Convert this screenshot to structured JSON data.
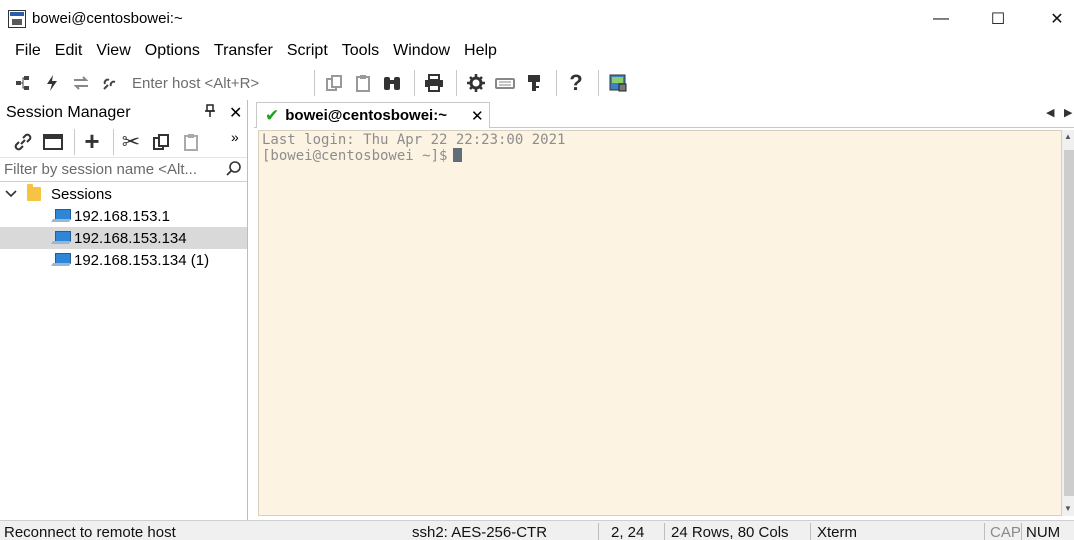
{
  "window": {
    "title": "bowei@centosbowei:~",
    "minimize_glyph": "—",
    "maximize_glyph": "☐",
    "close_glyph": "✕"
  },
  "menu": [
    "File",
    "Edit",
    "View",
    "Options",
    "Transfer",
    "Script",
    "Tools",
    "Window",
    "Help"
  ],
  "toolbar": {
    "host_placeholder": "Enter host <Alt+R>",
    "icons": [
      "connect-icon",
      "quick-connect-icon",
      "reconnect-icon",
      "disconnect-icon",
      "copy-icon",
      "paste-icon",
      "find-icon",
      "print-icon",
      "settings-icon",
      "keymap-icon",
      "key-icon",
      "help-icon",
      "sftp-icon"
    ]
  },
  "session_manager": {
    "title": "Session Manager",
    "filter_placeholder": "Filter by session name <Alt...",
    "tree": {
      "folder_label": "Sessions",
      "items": [
        {
          "label": "192.168.153.1",
          "selected": false
        },
        {
          "label": "192.168.153.134",
          "selected": true
        },
        {
          "label": "192.168.153.134 (1)",
          "selected": false
        }
      ]
    }
  },
  "tabs": [
    {
      "label": "bowei@centosbowei:~",
      "status": "connected"
    }
  ],
  "terminal": {
    "lines": [
      "Last login: Thu Apr 22 22:23:00 2021",
      "[bowei@centosbowei ~]$"
    ],
    "background": "#fcf3e2",
    "text_color": "#8d8d8d"
  },
  "status_bar": {
    "message": "Reconnect to remote host",
    "protocol": "ssh2: AES-256-CTR",
    "cursor_pos": "2,  24",
    "size": "24 Rows, 80 Cols",
    "terminal_type": "Xterm",
    "caps": "CAP",
    "num": "NUM"
  }
}
